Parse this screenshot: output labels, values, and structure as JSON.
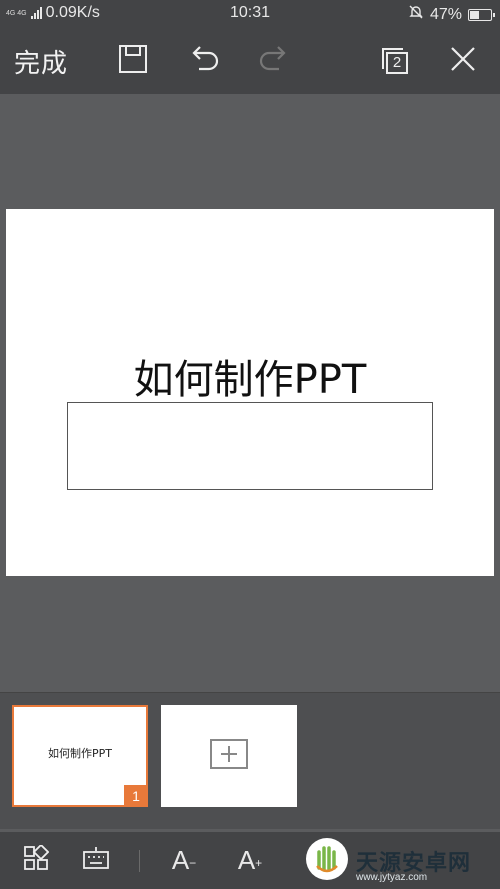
{
  "status_bar": {
    "network_type": "4G 4G",
    "speed": "0.09K/s",
    "time": "10:31",
    "battery": "47%",
    "battery_level": 0.47
  },
  "toolbar": {
    "done_label": "完成",
    "page_count": "2"
  },
  "slide": {
    "title": "如何制作PPT"
  },
  "thumbnails": {
    "items": [
      {
        "title": "如何制作PPT",
        "number": "1"
      }
    ]
  },
  "bottom_bar": {
    "decrease_font_label": "A",
    "decrease_font_sign": "−",
    "increase_font_label": "A",
    "increase_font_sign": "+"
  },
  "watermark": {
    "text": "天源安卓网",
    "url": "www.jytyaz.com"
  },
  "colors": {
    "accent": "#e8793a",
    "toolbar_bg": "#434446",
    "canvas_bg": "#5b5c5e"
  }
}
